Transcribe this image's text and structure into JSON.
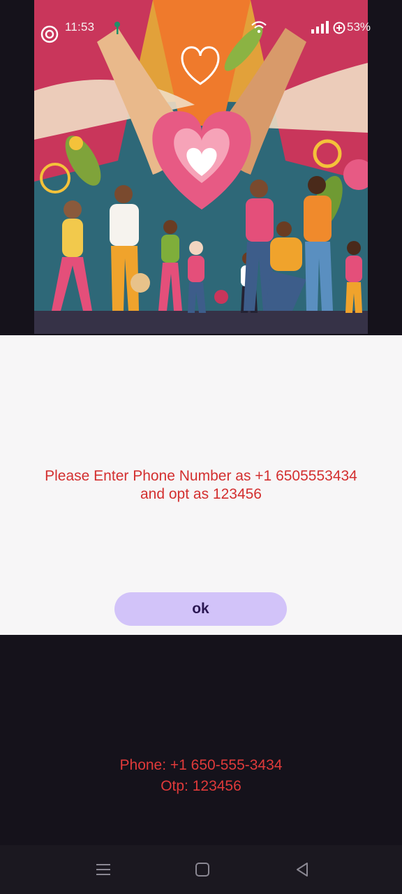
{
  "status_bar": {
    "time": "11:53",
    "battery": "53%",
    "icons": [
      "target-icon",
      "key-icon",
      "wifi-icon",
      "signal-icon",
      "battery-icon"
    ]
  },
  "hero": {
    "description_icon": "community-heart-illustration"
  },
  "dialog": {
    "message": "Please Enter Phone Number as +1 6505553434\nand opt as 123456",
    "ok_label": "ok"
  },
  "info": {
    "phone": "Phone: +1 650-555-3434",
    "otp": "Otp: 123456"
  },
  "nav_bar": {
    "icons": [
      "menu-icon",
      "home-icon",
      "back-icon"
    ]
  },
  "colors": {
    "background": "#15121b",
    "dialog_bg": "#f7f6f7",
    "message_red": "#d32f2f",
    "button_bg": "#d2c3f9",
    "button_text": "#2b1753",
    "info_red": "#e03a3a"
  }
}
